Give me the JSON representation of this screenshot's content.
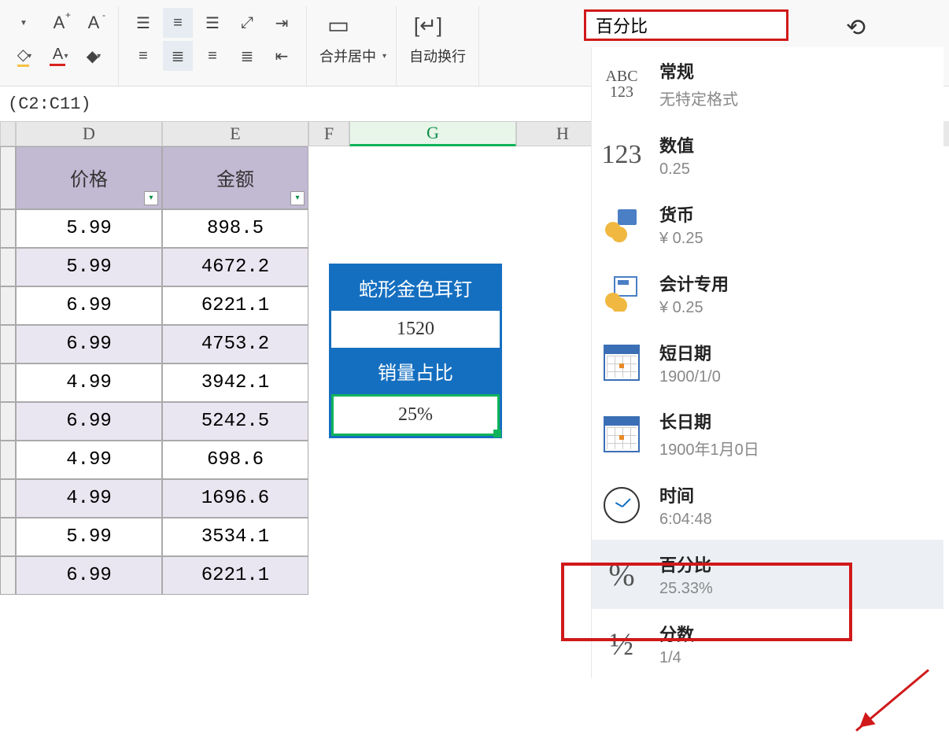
{
  "ribbon": {
    "merge_center": "合并居中",
    "auto_wrap": "自动换行"
  },
  "formula_bar": "(C2:C11)",
  "columns": [
    "D",
    "E",
    "F",
    "G",
    "H"
  ],
  "table": {
    "headers": [
      "价格",
      "金额"
    ],
    "rows": [
      [
        "5.99",
        "898.5"
      ],
      [
        "5.99",
        "4672.2"
      ],
      [
        "6.99",
        "6221.1"
      ],
      [
        "6.99",
        "4753.2"
      ],
      [
        "4.99",
        "3942.1"
      ],
      [
        "6.99",
        "5242.5"
      ],
      [
        "4.99",
        "698.6"
      ],
      [
        "4.99",
        "1696.6"
      ],
      [
        "5.99",
        "3534.1"
      ],
      [
        "6.99",
        "6221.1"
      ]
    ]
  },
  "info_box": {
    "r1": "蛇形金色耳钉",
    "r2": "1520",
    "r3": "销量占比",
    "r4": "25%"
  },
  "format_selector": "百分比",
  "formats": [
    {
      "icon_top": "ABC",
      "icon_bot": "123",
      "title": "常规",
      "sub": "无特定格式"
    },
    {
      "icon": "123",
      "title": "数值",
      "sub": "0.25"
    },
    {
      "icon": "coins",
      "title": "货币",
      "sub": "¥ 0.25"
    },
    {
      "icon": "ledger",
      "title": "会计专用",
      "sub": "¥ 0.25"
    },
    {
      "icon": "cal",
      "title": "短日期",
      "sub": "1900/1/0"
    },
    {
      "icon": "cal",
      "title": "长日期",
      "sub": "1900年1月0日"
    },
    {
      "icon": "clock",
      "title": "时间",
      "sub": "6:04:48"
    },
    {
      "icon": "%",
      "title": "百分比",
      "sub": "25.33%"
    },
    {
      "icon": "½",
      "title": "分数",
      "sub": "1/4"
    }
  ]
}
